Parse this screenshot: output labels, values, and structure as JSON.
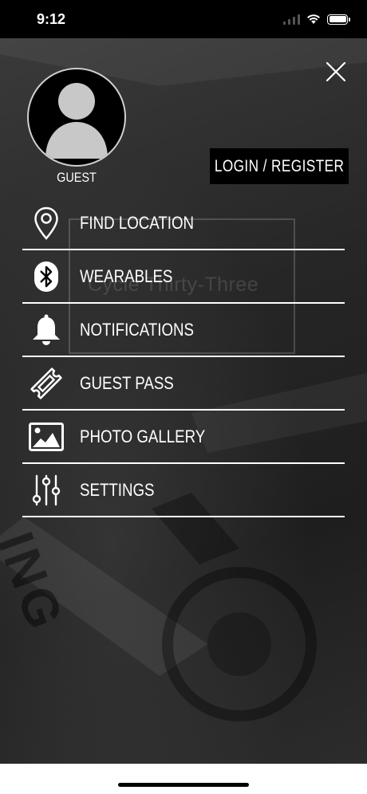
{
  "status_bar": {
    "time": "9:12"
  },
  "background": {
    "brand_text": "Cycle Thirty-Three",
    "lettering": "ING"
  },
  "profile": {
    "name": "GUEST"
  },
  "auth": {
    "login_label": "LOGIN / REGISTER"
  },
  "menu": {
    "items": [
      {
        "label": "FIND LOCATION",
        "icon": "location-pin-icon"
      },
      {
        "label": "WEARABLES",
        "icon": "bluetooth-icon"
      },
      {
        "label": "NOTIFICATIONS",
        "icon": "bell-icon"
      },
      {
        "label": "GUEST PASS",
        "icon": "ticket-icon"
      },
      {
        "label": "PHOTO GALLERY",
        "icon": "photo-icon"
      },
      {
        "label": "SETTINGS",
        "icon": "sliders-icon"
      }
    ]
  },
  "colors": {
    "accent": "#000000",
    "text": "#ffffff",
    "overlay": "#2a2a2a"
  }
}
